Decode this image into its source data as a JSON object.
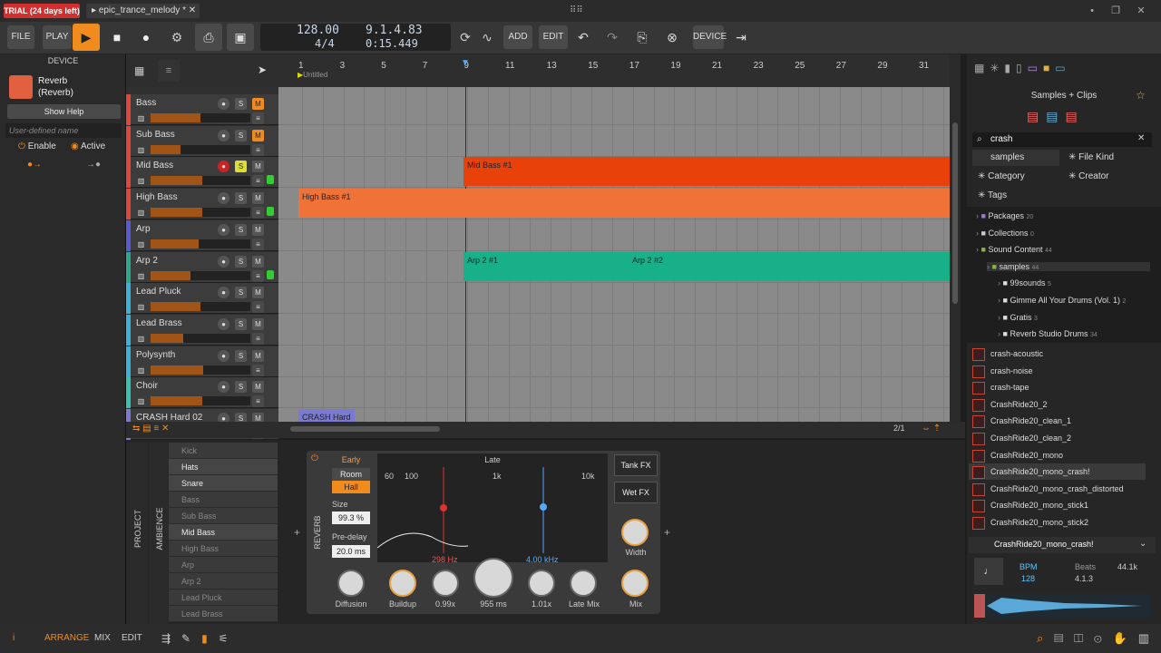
{
  "topbar": {
    "trial": "TRIAL (24 days left)",
    "project_tab": "epic_trance_melody *"
  },
  "toolbar": {
    "file": "FILE",
    "play": "PLAY",
    "add": "ADD",
    "edit": "EDIT",
    "device": "DEVICE"
  },
  "transport": {
    "tempo": "128.00",
    "signature": "4/4",
    "position": "9.1.4.83",
    "time": "0:15.449"
  },
  "device_panel": {
    "title": "DEVICE",
    "device_name": "Reverb",
    "device_sub": "(Reverb)",
    "help": "Show Help",
    "name_placeholder": "User-defined name",
    "enable": "Enable",
    "active": "Active"
  },
  "ruler": {
    "bars": [
      "1",
      "3",
      "5",
      "7",
      "9",
      "11",
      "13",
      "15",
      "17",
      "19",
      "21",
      "23",
      "25",
      "27",
      "29",
      "31"
    ],
    "marker": "Untitled"
  },
  "tracks": [
    {
      "name": "Bass",
      "color": "#e0473a",
      "vol": 0.5
    },
    {
      "name": "Sub Bass",
      "color": "#e0473a",
      "vol": 0.3
    },
    {
      "name": "Mid Bass",
      "color": "#e0473a",
      "vol": 0.52
    },
    {
      "name": "High Bass",
      "color": "#e0473a",
      "vol": 0.52
    },
    {
      "name": "Arp",
      "color": "#5a5ad0",
      "vol": 0.48
    },
    {
      "name": "Arp 2",
      "color": "#2aa88a",
      "vol": 0.4
    },
    {
      "name": "Lead Pluck",
      "color": "#3bb0d8",
      "vol": 0.5
    },
    {
      "name": "Lead Brass",
      "color": "#3bb0d8",
      "vol": 0.33
    },
    {
      "name": "Polysynth",
      "color": "#3bb0d8",
      "vol": 0.53
    },
    {
      "name": "Choir",
      "color": "#3bc0b0",
      "vol": 0.52
    },
    {
      "name": "CRASH Hard 02",
      "color": "#7a7ad0",
      "vol": 0.5
    }
  ],
  "clips": [
    {
      "label": "Mid Bass #1"
    },
    {
      "label": "High Bass #1"
    },
    {
      "label": "Arp 2 #1"
    },
    {
      "label": "Arp 2 #2"
    },
    {
      "label": "CRASH Hard 02"
    }
  ],
  "arrange_footer": {
    "zoom": "2/1"
  },
  "browser": {
    "title": "Samples + Clips",
    "search": "crash",
    "samples_tab": "samples",
    "file_kind": "File Kind",
    "category": "Category",
    "creator": "Creator",
    "tags": "Tags",
    "tree": [
      {
        "label": "Packages",
        "count": "20"
      },
      {
        "label": "Collections",
        "count": "0"
      },
      {
        "label": "Sound Content",
        "count": "44"
      },
      {
        "label": "samples",
        "count": "44"
      },
      {
        "label": "99sounds",
        "count": "5"
      },
      {
        "label": "Gimme All Your Drums (Vol. 1)",
        "count": "2"
      },
      {
        "label": "Gratis",
        "count": "3"
      },
      {
        "label": "Reverb Studio Drums",
        "count": "34"
      }
    ],
    "files": [
      "crash-acoustic",
      "crash-noise",
      "crash-tape",
      "CrashRide20_2",
      "CrashRide20_clean_1",
      "CrashRide20_clean_2",
      "CrashRide20_mono",
      "CrashRide20_mono_crash!",
      "CrashRide20_mono_crash_distorted",
      "CrashRide20_mono_stick1",
      "CrashRide20_mono_stick2"
    ],
    "selected": "CrashRide20_mono_crash!",
    "bpm_label": "BPM",
    "bpm": "128",
    "beats_label": "Beats",
    "beats": "4.1.3",
    "rate": "44.1k"
  },
  "chain": {
    "project": "PROJECT",
    "ambience": "AMBIENCE",
    "items": [
      "Kick",
      "Hats",
      "Snare",
      "Bass",
      "Sub Bass",
      "Mid Bass",
      "High Bass",
      "Arp",
      "Arp 2",
      "Lead Pluck",
      "Lead Brass"
    ]
  },
  "reverb": {
    "title": "REVERB",
    "early": "Early",
    "room": "Room",
    "hall": "Hall",
    "size_label": "Size",
    "size": "99.3 %",
    "predelay_label": "Pre-delay",
    "predelay": "20.0 ms",
    "diffusion": "Diffusion",
    "late": "Late",
    "f60": "60",
    "f100": "100",
    "f1k": "1k",
    "f10k": "10k",
    "lowfreq": "298 Hz",
    "highfreq": "4.00 kHz",
    "buildup": "Buildup",
    "v099": "0.99x",
    "v955": "955 ms",
    "v101": "1.01x",
    "latemix": "Late Mix",
    "tankfx": "Tank FX",
    "wetfx": "Wet FX",
    "width": "Width",
    "mix": "Mix"
  },
  "statusbar": {
    "arrange": "ARRANGE",
    "mix": "MIX",
    "edit": "EDIT"
  }
}
